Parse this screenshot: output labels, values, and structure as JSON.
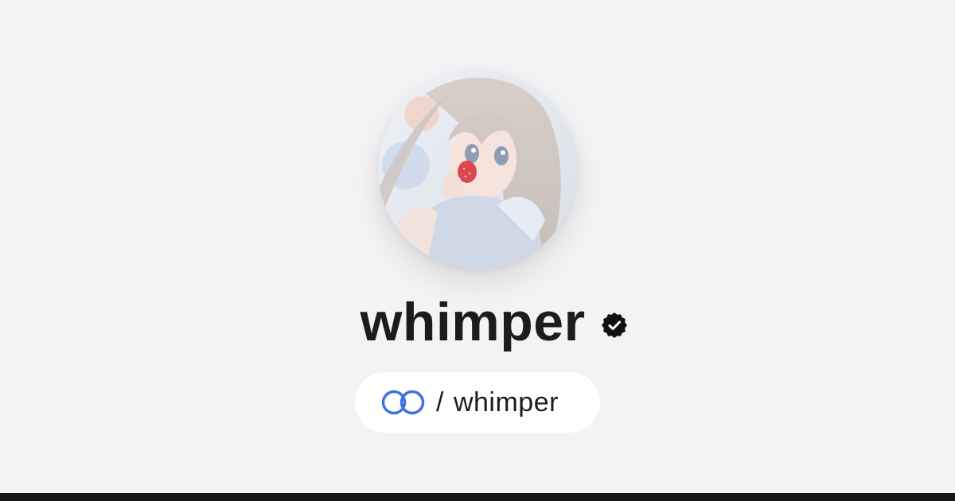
{
  "profile": {
    "name": "whimper",
    "avatar_alt": "profile avatar illustration",
    "verified": true
  },
  "handle": {
    "prefix": "/",
    "username": "whimper",
    "icon": "linked-rings-icon"
  },
  "colors": {
    "background": "#f3f3f5",
    "text": "#1c1c1e",
    "pill_background": "#ffffff",
    "link_icon_blue": "#3f72e0",
    "verified_badge": "#111111",
    "bottom_bar": "#17171a"
  }
}
